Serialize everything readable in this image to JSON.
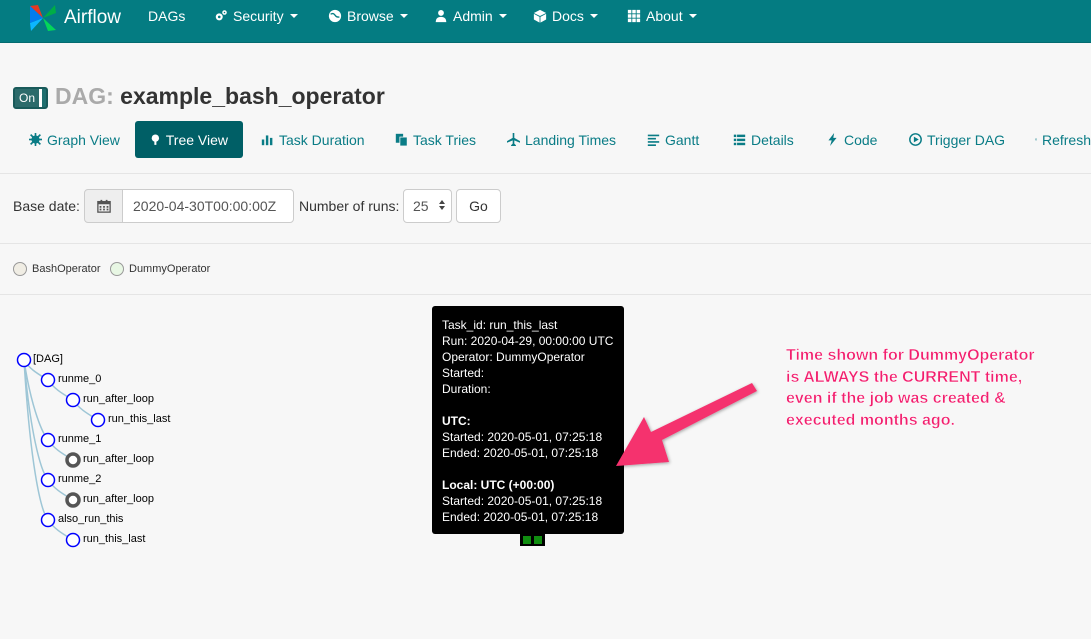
{
  "navbar": {
    "brand": "Airflow",
    "items": [
      {
        "label": "DAGs",
        "icon": "",
        "dropdown": false
      },
      {
        "label": "Security",
        "icon": "cogs-icon",
        "dropdown": true
      },
      {
        "label": "Browse",
        "icon": "globe-icon",
        "dropdown": true
      },
      {
        "label": "Admin",
        "icon": "user-icon",
        "dropdown": true
      },
      {
        "label": "Docs",
        "icon": "cube-icon",
        "dropdown": true
      },
      {
        "label": "About",
        "icon": "grid-icon",
        "dropdown": true
      }
    ]
  },
  "dag": {
    "toggle_label": "On",
    "prefix": "DAG:",
    "name": "example_bash_operator"
  },
  "tabs": [
    {
      "label": "Graph View",
      "icon": "asterisk-icon",
      "active": false
    },
    {
      "label": "Tree View",
      "icon": "tree-icon",
      "active": true
    },
    {
      "label": "Task Duration",
      "icon": "bar-chart-icon",
      "active": false
    },
    {
      "label": "Task Tries",
      "icon": "duplicate-icon",
      "active": false
    },
    {
      "label": "Landing Times",
      "icon": "plane-icon",
      "active": false
    },
    {
      "label": "Gantt",
      "icon": "align-left-icon",
      "active": false
    },
    {
      "label": "Details",
      "icon": "list-icon",
      "active": false
    },
    {
      "label": "Code",
      "icon": "flash-icon",
      "active": false
    },
    {
      "label": "Trigger DAG",
      "icon": "play-circle-icon",
      "active": false
    },
    {
      "label": "Refresh",
      "icon": "refresh-icon",
      "active": false
    }
  ],
  "form": {
    "base_date_label": "Base date:",
    "base_date_value": "2020-04-30T00:00:00Z",
    "num_runs_label": "Number of runs:",
    "num_runs_value": "25",
    "go_label": "Go"
  },
  "legend": [
    {
      "label": "BashOperator",
      "color": "#f0ede4"
    },
    {
      "label": "DummyOperator",
      "color": "#e8f7e4"
    }
  ],
  "tree": {
    "nodes": [
      {
        "label": "[DAG]",
        "depth": 0,
        "style": "hollow"
      },
      {
        "label": "runme_0",
        "depth": 1,
        "style": "hollow"
      },
      {
        "label": "run_after_loop",
        "depth": 2,
        "style": "hollow"
      },
      {
        "label": "run_this_last",
        "depth": 3,
        "style": "hollow"
      },
      {
        "label": "runme_1",
        "depth": 1,
        "style": "hollow"
      },
      {
        "label": "run_after_loop",
        "depth": 2,
        "style": "filled"
      },
      {
        "label": "runme_2",
        "depth": 1,
        "style": "hollow"
      },
      {
        "label": "run_after_loop",
        "depth": 2,
        "style": "filled"
      },
      {
        "label": "also_run_this",
        "depth": 1,
        "style": "hollow"
      },
      {
        "label": "run_this_last",
        "depth": 2,
        "style": "hollow"
      }
    ]
  },
  "tooltip": {
    "task_id": "Task_id: run_this_last",
    "run": "Run: 2020-04-29, 00:00:00 UTC",
    "operator": "Operator: DummyOperator",
    "started": "Started:",
    "duration": "Duration:",
    "utc_heading": "UTC:",
    "utc_started": "Started: 2020-05-01, 07:25:18",
    "utc_ended": "Ended: 2020-05-01, 07:25:18",
    "local_heading": "Local: UTC (+00:00)",
    "local_started": "Started: 2020-05-01, 07:25:18",
    "local_ended": "Ended: 2020-05-01, 07:25:18"
  },
  "annotation": {
    "lines": [
      "Time shown for DummyOperator",
      "is ALWAYS the CURRENT time,",
      "even if the job was created &",
      "executed months ago."
    ],
    "color": "#f21f6e"
  },
  "colors": {
    "navbar": "#047c82",
    "accent": "#0a7c86",
    "success": "#108d10"
  }
}
